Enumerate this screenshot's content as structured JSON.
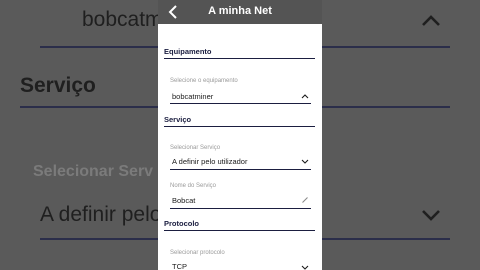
{
  "background": {
    "top_select_value": "bobcatminer",
    "service_heading": "Serviço",
    "service_select_label": "Selecionar Serv",
    "service_select_value": "A definir pelo"
  },
  "header": {
    "title": "A minha Net"
  },
  "sections": {
    "equipment": {
      "heading": "Equipamento",
      "select_label": "Selecione o equipamento",
      "select_value": "bobcatminer",
      "chevron": "chevron-up-icon"
    },
    "service": {
      "heading": "Serviço",
      "select_label": "Selecionar Serviço",
      "select_value": "A definir pelo utilizador",
      "chevron": "chevron-down-icon",
      "name_label": "Nome do Serviço",
      "name_value": "Bobcat",
      "name_icon": "pencil-icon"
    },
    "protocol": {
      "heading": "Protocolo",
      "select_label": "Selecionar protocolo",
      "select_value": "TCP",
      "chevron": "chevron-down-icon"
    }
  },
  "colors": {
    "header_bg": "#545454",
    "accent": "#1b1e40",
    "overlay": "#5a5a5a"
  }
}
